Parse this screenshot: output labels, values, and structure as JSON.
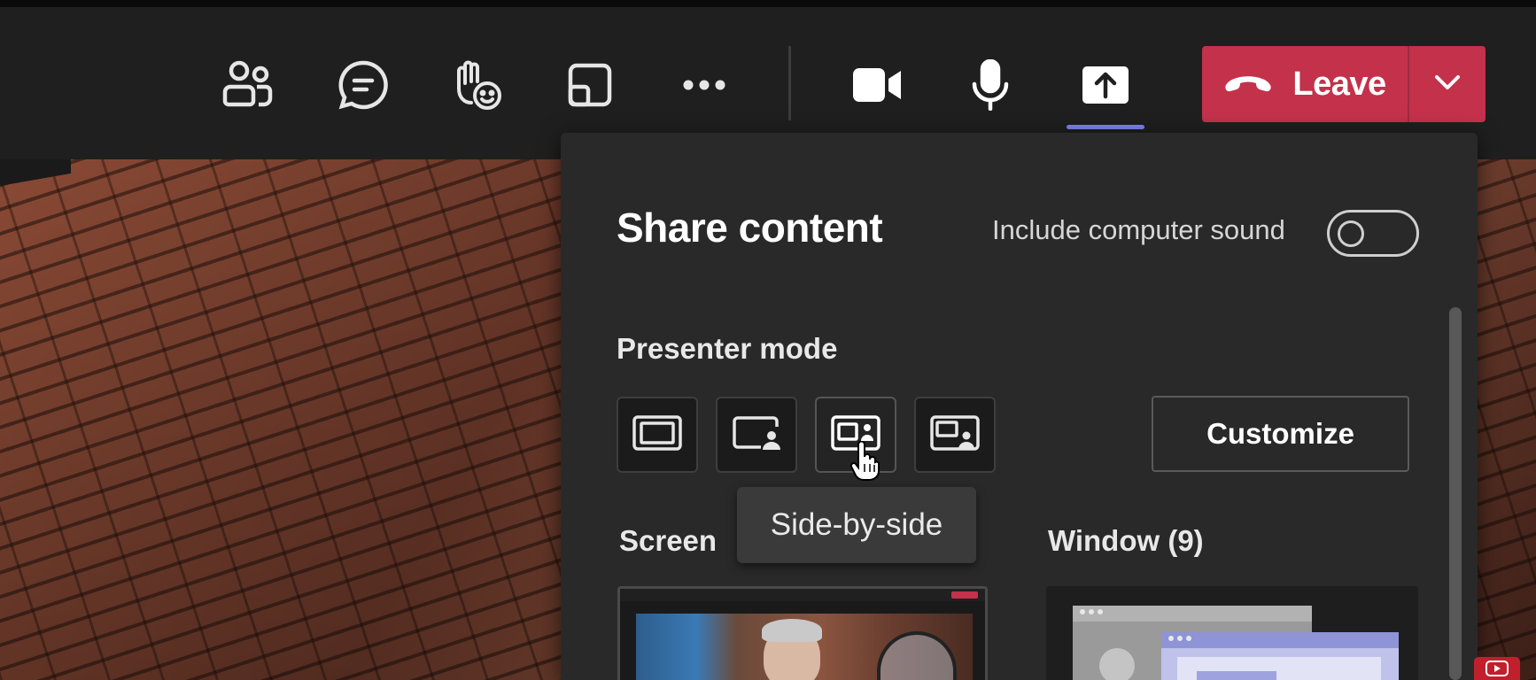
{
  "toolbar": {
    "buttons": [
      {
        "id": "people",
        "icon": "people-icon"
      },
      {
        "id": "chat",
        "icon": "chat-icon"
      },
      {
        "id": "react",
        "icon": "raise-hand-react-icon"
      },
      {
        "id": "rooms",
        "icon": "rooms-icon"
      },
      {
        "id": "more",
        "icon": "more-horizontal-icon"
      },
      {
        "id": "camera",
        "icon": "camera-icon"
      },
      {
        "id": "mic",
        "icon": "microphone-icon"
      },
      {
        "id": "share",
        "icon": "share-tray-icon",
        "active": true
      }
    ],
    "leave": {
      "label": "Leave",
      "icon": "hang-up-icon",
      "color": "#c4314b"
    }
  },
  "share_panel": {
    "title": "Share content",
    "include_sound_label": "Include computer sound",
    "include_sound_on": false,
    "presenter_mode_label": "Presenter mode",
    "modes": [
      {
        "id": "content-only",
        "icon": "content-only-icon"
      },
      {
        "id": "standout",
        "icon": "standout-icon"
      },
      {
        "id": "side-by-side",
        "icon": "side-by-side-icon",
        "hovered": true
      },
      {
        "id": "reporter",
        "icon": "reporter-icon"
      }
    ],
    "tooltip": "Side-by-side",
    "customize_label": "Customize",
    "screen_label": "Screen",
    "window_label": "Window (9)"
  },
  "colors": {
    "accent": "#7f85f5",
    "leave": "#c4314b",
    "panel": "#292929",
    "toolbar": "#1f1f1f"
  }
}
